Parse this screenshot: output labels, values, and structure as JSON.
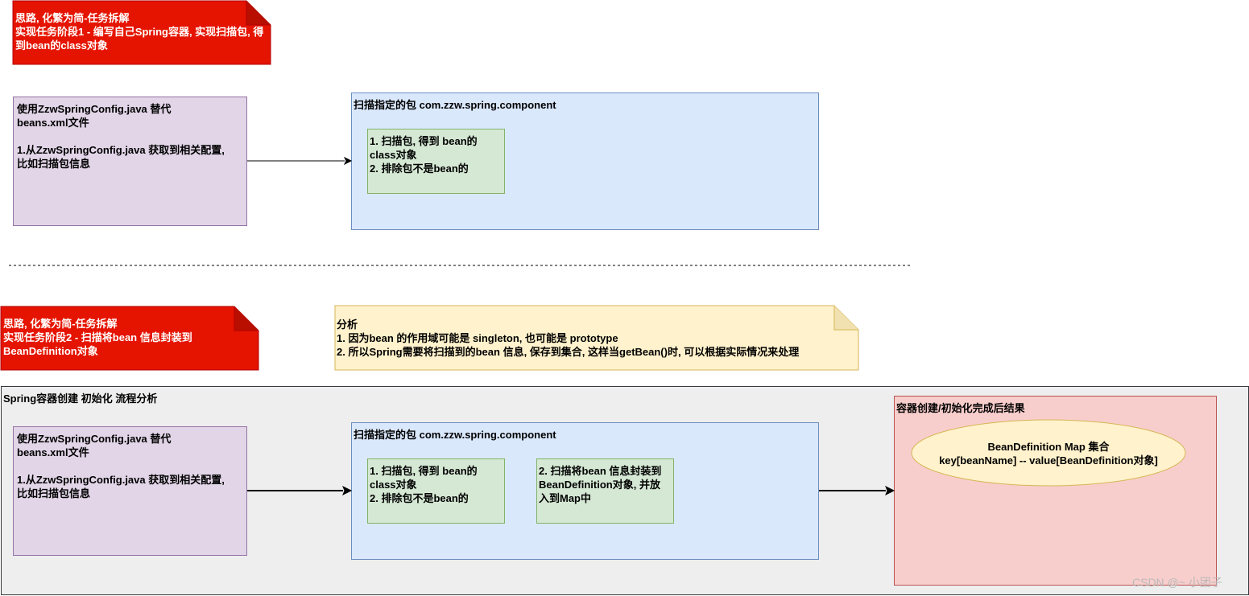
{
  "section1": {
    "note": "思路, 化繁为简-任务拆解\n实现任务阶段1 - 编写自己Spring容器, 实现扫描包, 得到bean的class对象",
    "config_box": "使用ZzwSpringConfig.java 替代\nbeans.xml文件\n\n1.从ZzwSpringConfig.java 获取到相关配置,\n比如扫描包信息",
    "scan_box_title": "扫描指定的包 com.zzw.spring.component",
    "scan_step": "1. 扫描包, 得到 bean的\nclass对象\n2. 排除包不是bean的"
  },
  "section2": {
    "note": "思路, 化繁为简-任务拆解\n实现任务阶段2 - 扫描将bean 信息封装到\nBeanDefinition对象",
    "analysis": "分析\n1. 因为bean 的作用域可能是 singleton, 也可能是 prototype\n2. 所以Spring需要将扫描到的bean 信息, 保存到集合, 这样当getBean()时, 可以根据实际情况来处理",
    "container_title": "Spring容器创建 初始化 流程分析",
    "config_box": "使用ZzwSpringConfig.java 替代\nbeans.xml文件\n\n1.从ZzwSpringConfig.java 获取到相关配置,\n比如扫描包信息",
    "scan_box_title": "扫描指定的包 com.zzw.spring.component",
    "scan_step1": "1. 扫描包, 得到 bean的\nclass对象\n2. 排除包不是bean的",
    "scan_step2": "2. 扫描将bean 信息封装到\nBeanDefinition对象, 并放\n入到Map中",
    "result_title": "容器创建/初始化完成后结果",
    "result_map": "BeanDefinition Map 集合\nkey[beanName] -- value[BeanDefinition对象]"
  },
  "watermark": "CSDN @~ 小团子",
  "colors": {
    "note_red": "#e51400",
    "purple": "#e1d5e7",
    "blue": "#dae8fc",
    "green": "#d5e8d4",
    "yellow": "#fff2cc",
    "pink": "#f8cecc",
    "grey": "#eeeeee"
  }
}
